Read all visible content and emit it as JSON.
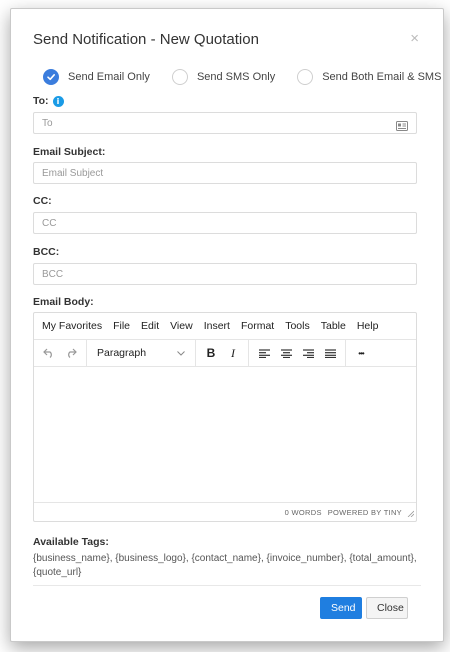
{
  "modal": {
    "title": "Send Notification - New Quotation",
    "close_glyph": "×"
  },
  "send_options": [
    {
      "label": "Send Email Only",
      "checked": true
    },
    {
      "label": "Send SMS Only",
      "checked": false
    },
    {
      "label": "Send Both Email & SMS",
      "checked": false
    }
  ],
  "fields": {
    "to": {
      "label": "To:",
      "placeholder": "To",
      "value": ""
    },
    "subject": {
      "label": "Email Subject:",
      "placeholder": "Email Subject",
      "value": ""
    },
    "cc": {
      "label": "CC:",
      "placeholder": "CC",
      "value": ""
    },
    "bcc": {
      "label": "BCC:",
      "placeholder": "BCC",
      "value": ""
    }
  },
  "info_glyph": "i",
  "editor": {
    "label": "Email Body:",
    "menu": [
      "My Favorites",
      "File",
      "Edit",
      "View",
      "Insert",
      "Format",
      "Tools",
      "Table",
      "Help"
    ],
    "block_format": "Paragraph",
    "bold": "B",
    "italic": "I",
    "more": "•••",
    "word_count": "0 WORDS",
    "powered_by": "POWERED BY TINY"
  },
  "tags": {
    "title": "Available Tags:",
    "text": "{business_name}, {business_logo}, {contact_name}, {invoice_number}, {total_amount}, {quote_url}"
  },
  "buttons": {
    "send": "Send",
    "close": "Close"
  },
  "colors": {
    "primary": "#1f7ee0",
    "radio_checked": "#3b7ddd",
    "info": "#1a9be6"
  }
}
